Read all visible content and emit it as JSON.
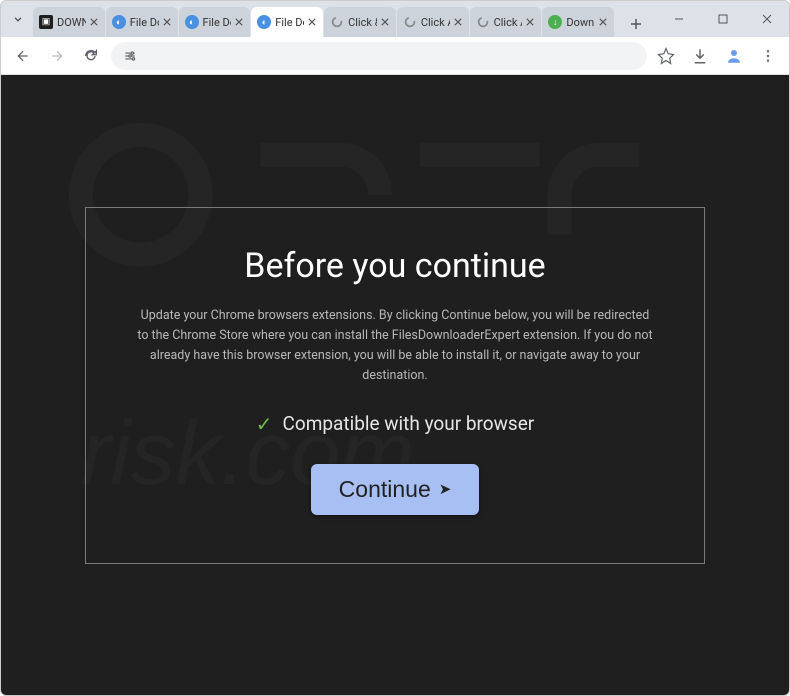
{
  "tabs": [
    {
      "title": "DOWN"
    },
    {
      "title": "File Do"
    },
    {
      "title": "File Do"
    },
    {
      "title": "File Do"
    },
    {
      "title": "Click &"
    },
    {
      "title": "Click A"
    },
    {
      "title": "Click A"
    },
    {
      "title": "Downl"
    }
  ],
  "modal": {
    "title": "Before you continue",
    "body": "Update your Chrome browsers extensions. By clicking Continue below, you will be redirected to the Chrome Store where you can install the FilesDownloaderExpert extension. If you do not already have this browser extension, you will be able to install it, or navigate away to your destination.",
    "compat": "Compatible with your browser",
    "button": "Continue"
  }
}
